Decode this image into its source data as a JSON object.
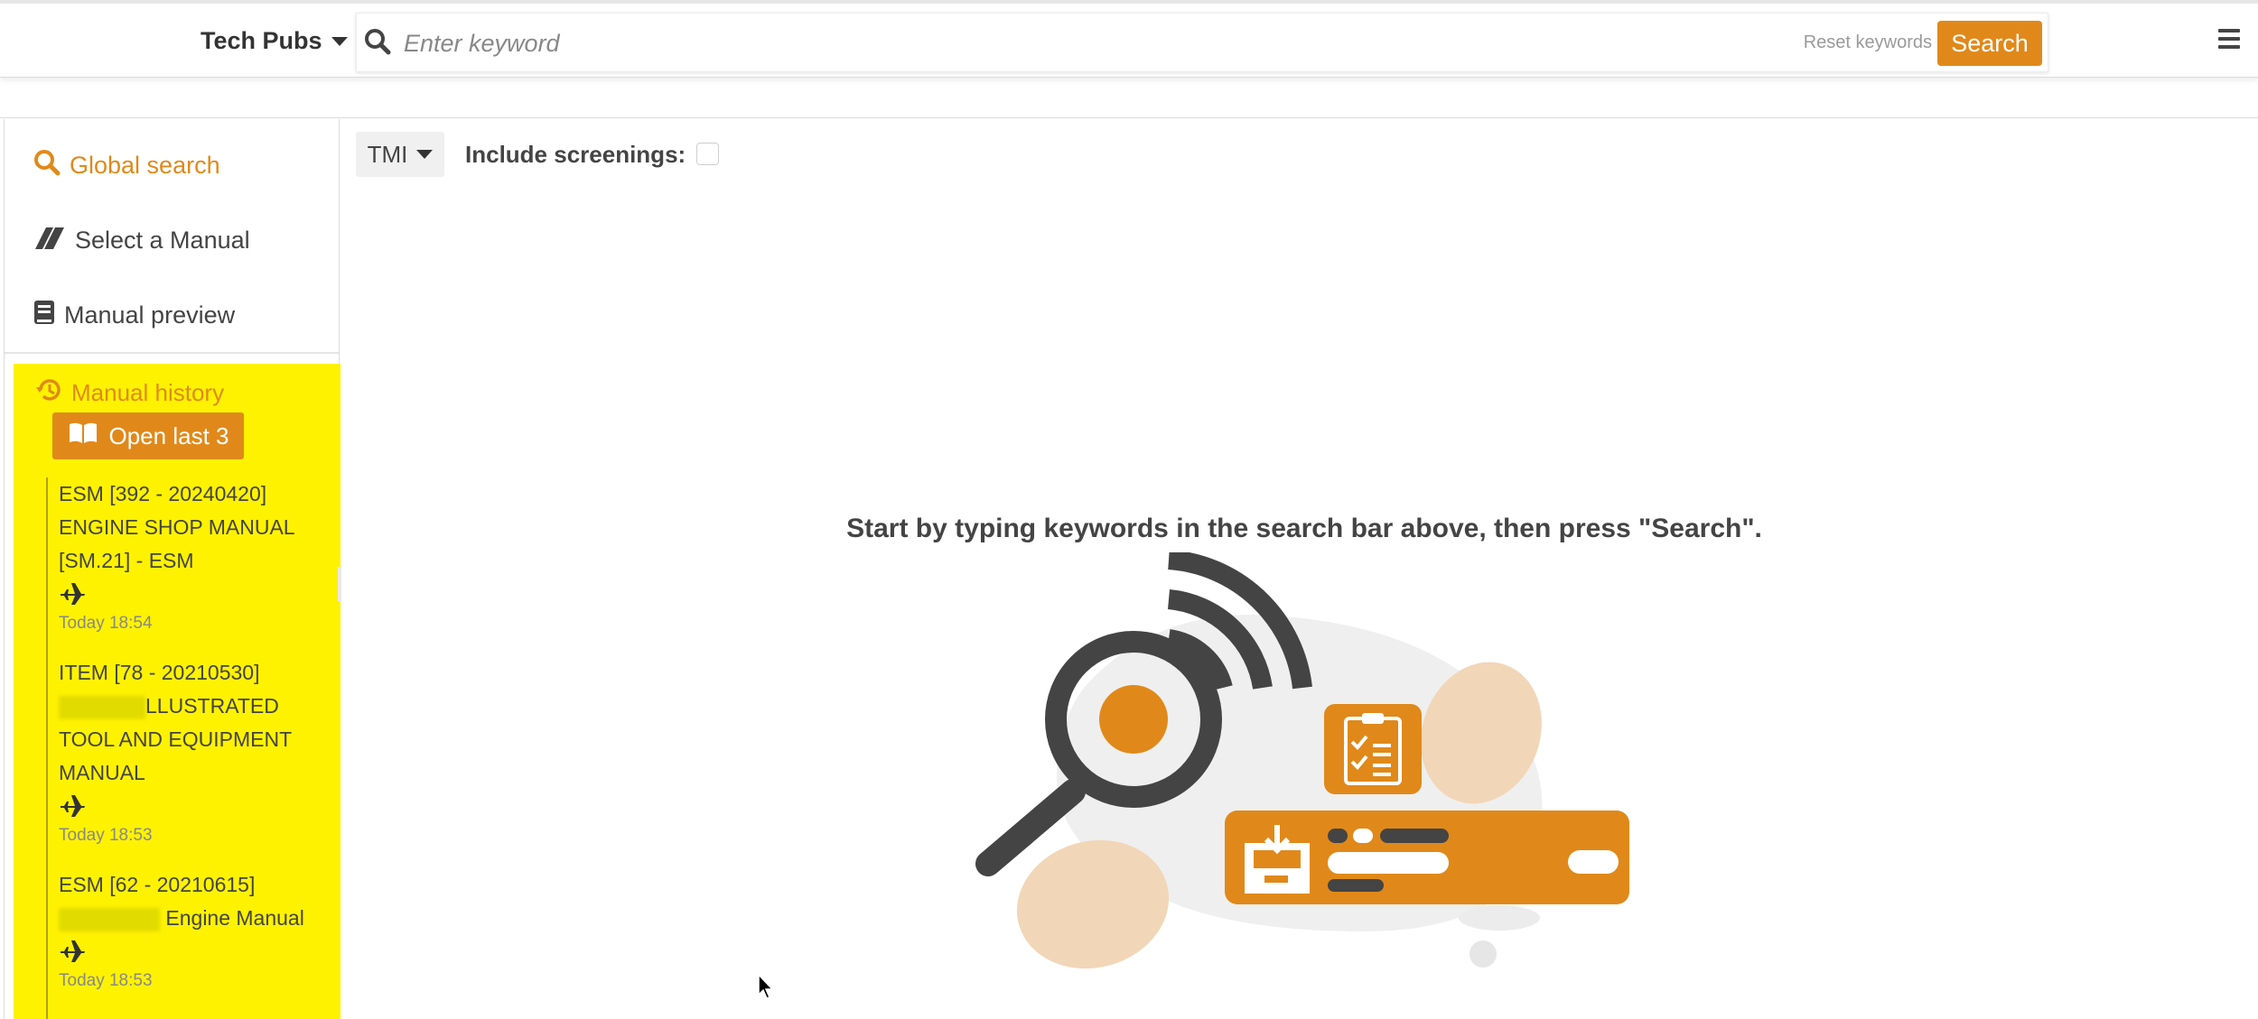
{
  "header": {
    "app_name": "Tech Pubs",
    "search_placeholder": "Enter keyword",
    "search_value": "",
    "reset_label": "Reset keywords",
    "search_button": "Search",
    "menu_icon": "hamburger-menu-icon"
  },
  "sidebar": {
    "nav": [
      {
        "label": "Global search",
        "icon": "search-icon",
        "active": true
      },
      {
        "label": "Select a Manual",
        "icon": "manual-pages-icon",
        "active": false
      },
      {
        "label": "Manual preview",
        "icon": "book-icon",
        "active": false
      }
    ],
    "history": {
      "title": "Manual history",
      "open_last_label": "Open last 3",
      "items": [
        {
          "name": "ESM [392 - 20240420] ENGINE SHOP MANUAL [SM.21] - ESM",
          "time": "Today 18:54",
          "icon": "airplane-icon"
        },
        {
          "name_before": "ITEM [78 - 20210530]",
          "name_after": "LLUSTRATED TOOL AND EQUIPMENT MANUAL",
          "time": "Today 18:53",
          "icon": "airplane-icon"
        },
        {
          "name_before": "ESM [62 - 20210615]",
          "name_after": "Engine Manual",
          "time": "Today 18:53",
          "icon": "airplane-icon"
        }
      ]
    },
    "colors": {
      "accent": "#e0891a",
      "history_bg": "#fff200"
    }
  },
  "content": {
    "source_filter": "TMI",
    "include_screenings_label": "Include screenings:",
    "include_screenings_checked": false,
    "empty_message": "Start by typing keywords in the search bar above, then press \"Search\"."
  }
}
